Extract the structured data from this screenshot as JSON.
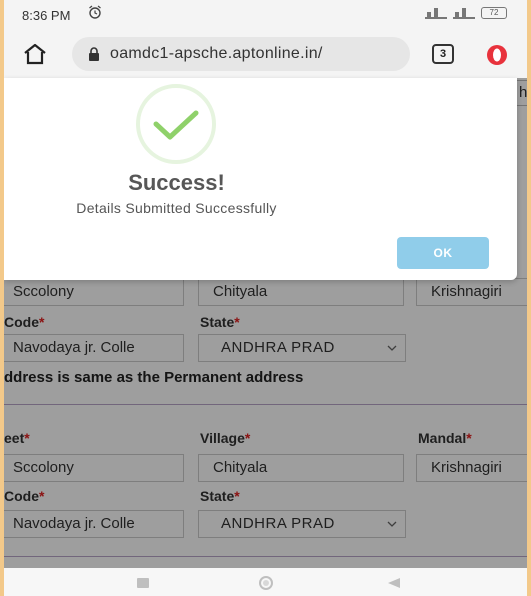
{
  "status_bar": {
    "time": "8:36 PM",
    "battery": "72"
  },
  "browser": {
    "url": "oamdc1-apsche.aptonline.in/",
    "tab_count": "3"
  },
  "form": {
    "top_partial_field": "h",
    "permanent": {
      "street_value": "Sccolony",
      "village_value": "Chityala",
      "mandal_value": "Krishnagiri",
      "code_label": "Code",
      "state_label": "State",
      "college_value": "Navodaya jr. Colle",
      "state_value": "ANDHRA PRAD"
    },
    "same_address_label": "ddress is same as the Permanent address",
    "present": {
      "street_label": "eet",
      "village_label": "Village",
      "mandal_label": "Mandal",
      "street_value": "Sccolony",
      "village_value": "Chityala",
      "mandal_value": "Krishnagiri",
      "code_label": "Code",
      "state_label": "State",
      "college_value": "Navodaya jr. Colle",
      "state_value": "ANDHRA PRAD"
    },
    "required_mark": "*"
  },
  "modal": {
    "title": "Success!",
    "message": "Details Submitted Successfully",
    "ok_label": "OK"
  },
  "colors": {
    "accent_ok": "#90cdea",
    "success_green": "#8fd16a",
    "required": "#e02020"
  }
}
